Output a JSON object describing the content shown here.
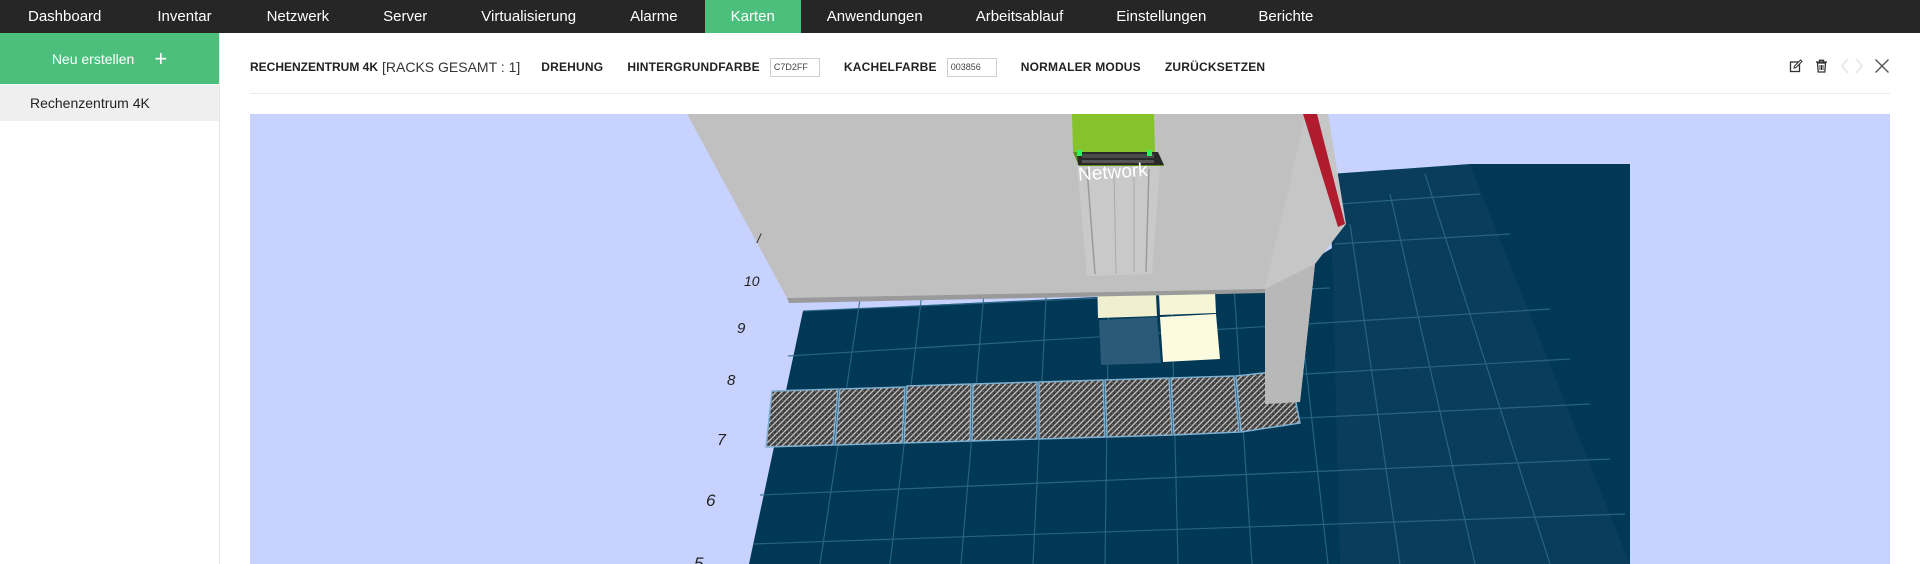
{
  "nav": {
    "items": [
      {
        "label": "Dashboard",
        "active": false
      },
      {
        "label": "Inventar",
        "active": false
      },
      {
        "label": "Netzwerk",
        "active": false
      },
      {
        "label": "Server",
        "active": false
      },
      {
        "label": "Virtualisierung",
        "active": false
      },
      {
        "label": "Alarme",
        "active": false
      },
      {
        "label": "Karten",
        "active": true
      },
      {
        "label": "Anwendungen",
        "active": false
      },
      {
        "label": "Arbeitsablauf",
        "active": false
      },
      {
        "label": "Einstellungen",
        "active": false
      },
      {
        "label": "Berichte",
        "active": false
      }
    ]
  },
  "sidebar": {
    "new_label": "Neu erstellen",
    "items": [
      {
        "label": "Rechenzentrum 4K"
      }
    ]
  },
  "toolbar": {
    "title": "RECHENZENTRUM 4K",
    "rack_count": "[RACKS GESAMT : 1]",
    "rotation_label": "DREHUNG",
    "bg_color_label": "HINTERGRUNDFARBE",
    "bg_color_value": "C7D2FF",
    "tile_color_label": "KACHELFARBE",
    "tile_color_value": "003856",
    "normal_mode_label": "NORMALER MODUS",
    "reset_label": "ZURÜCKSETZEN"
  },
  "scene": {
    "rack_label": "Network",
    "row_labels": [
      "10",
      "9",
      "8",
      "7",
      "6",
      "5"
    ],
    "background_color": "#C7D2FF",
    "tile_color": "#003856"
  },
  "colors": {
    "accent": "#4cbf7d",
    "nav_bg": "#262626"
  }
}
